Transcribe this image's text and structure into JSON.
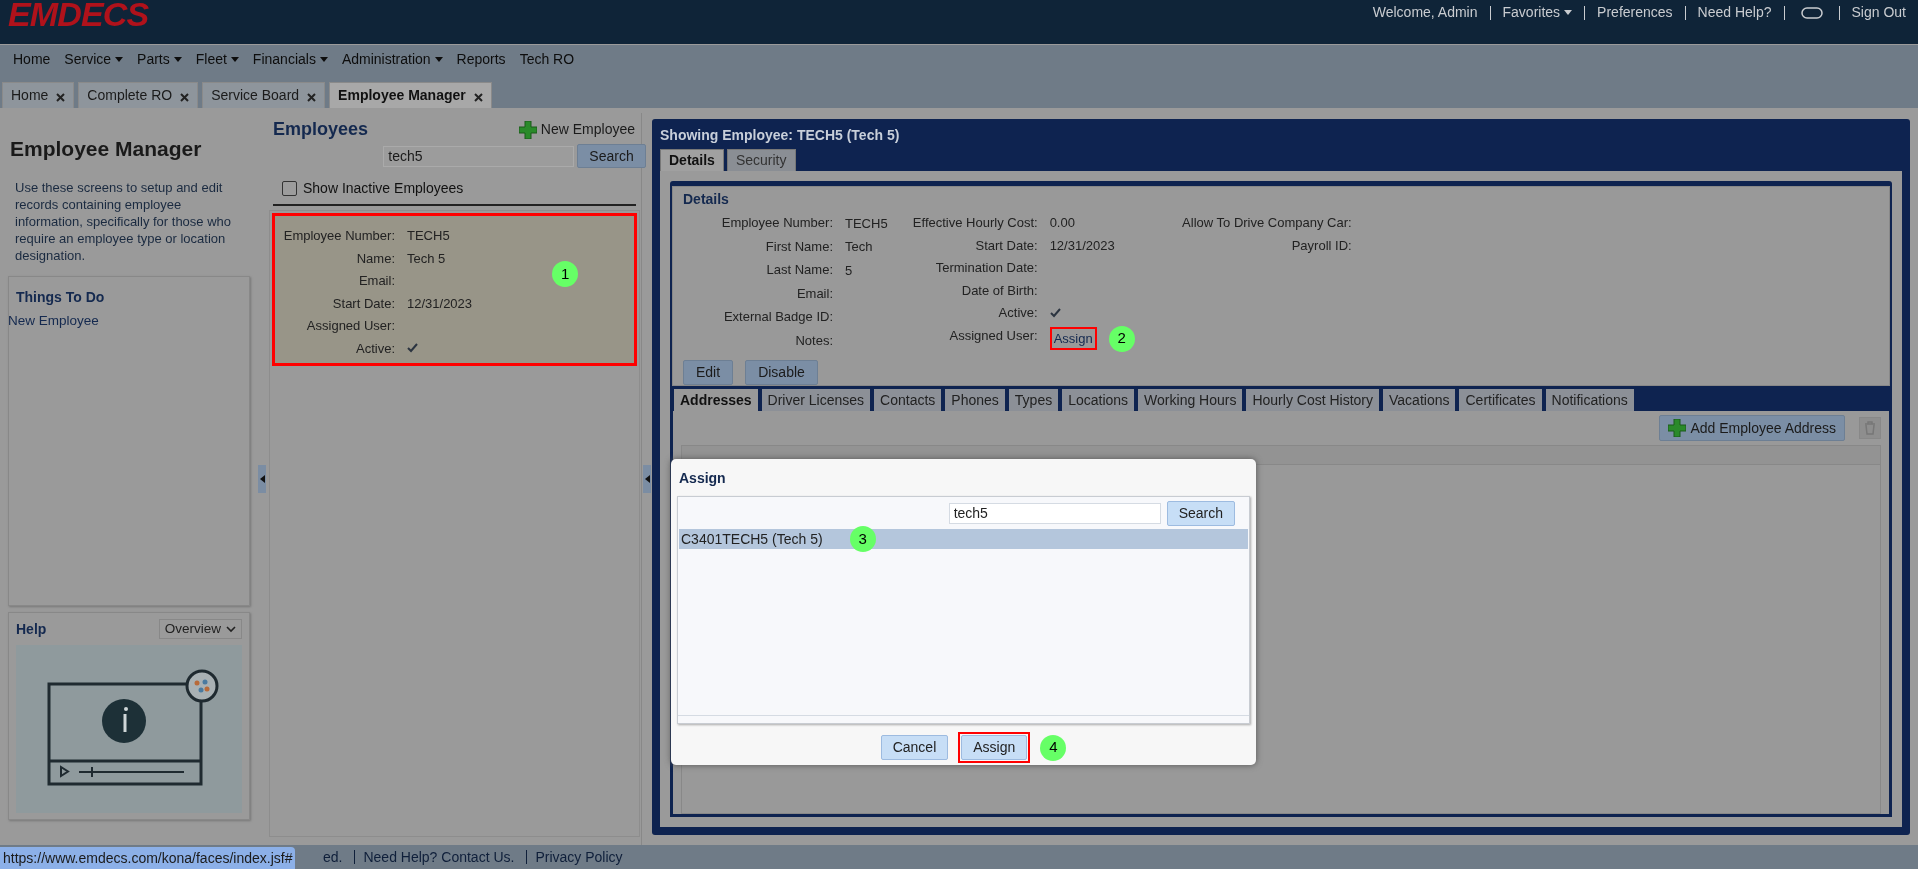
{
  "header": {
    "logo": "EMDECS",
    "links": [
      {
        "label": "Welcome, Admin",
        "kind": "text"
      },
      {
        "label": "Favorites",
        "kind": "menu"
      },
      {
        "label": "Preferences",
        "kind": "link"
      },
      {
        "label": "Need Help?",
        "kind": "link"
      },
      {
        "kind": "toggle"
      },
      {
        "label": "Sign Out",
        "kind": "link"
      }
    ]
  },
  "menu": [
    {
      "label": "Home",
      "dropdown": false
    },
    {
      "label": "Service",
      "dropdown": true
    },
    {
      "label": "Parts",
      "dropdown": true
    },
    {
      "label": "Fleet",
      "dropdown": true
    },
    {
      "label": "Financials",
      "dropdown": true
    },
    {
      "label": "Administration",
      "dropdown": true
    },
    {
      "label": "Reports",
      "dropdown": false
    },
    {
      "label": "Tech RO",
      "dropdown": false
    }
  ],
  "page_tabs": [
    {
      "label": "Home",
      "selected": false
    },
    {
      "label": "Complete RO",
      "selected": false
    },
    {
      "label": "Service Board",
      "selected": false
    },
    {
      "label": "Employee Manager",
      "selected": true
    }
  ],
  "sidebar": {
    "title": "Employee Manager",
    "description": "Use these screens to setup and edit records containing employee information, specifically for those who require an employee type or location designation.",
    "things_to_do": {
      "title": "Things To Do",
      "items": [
        "New Employee"
      ]
    },
    "help": {
      "title": "Help",
      "dropdown": "Overview"
    }
  },
  "employees": {
    "title": "Employees",
    "new_button": "New Employee",
    "search_value": "tech5",
    "search_button": "Search",
    "show_inactive": {
      "label": "Show Inactive Employees",
      "checked": false
    },
    "card": {
      "marker": "1",
      "fields": [
        {
          "label": "Employee Number:",
          "kind": "text",
          "value": "TECH5"
        },
        {
          "label": "Name:",
          "kind": "text",
          "value": "Tech 5"
        },
        {
          "label": "Email:",
          "kind": "text"
        },
        {
          "label": "Start Date:",
          "kind": "text",
          "value": "12/31/2023"
        },
        {
          "label": "Assigned User:",
          "kind": "text"
        },
        {
          "label": "Active:",
          "kind": "check",
          "checked": true
        }
      ]
    }
  },
  "detail": {
    "title": "Showing Employee: TECH5 (Tech 5)",
    "tabs": [
      {
        "label": "Details",
        "selected": true
      },
      {
        "label": "Security",
        "selected": false
      }
    ],
    "section_title": "Details",
    "columns": [
      [
        {
          "label": "Employee Number:",
          "kind": "text",
          "value": "TECH5"
        },
        {
          "label": "First Name:",
          "kind": "text",
          "value": "Tech"
        },
        {
          "label": "Last Name:",
          "kind": "text",
          "value": "5"
        },
        {
          "label": "Email:",
          "kind": "text"
        },
        {
          "label": "External Badge ID:",
          "kind": "text"
        },
        {
          "label": "Notes:",
          "kind": "text"
        }
      ],
      [
        {
          "label": "Effective Hourly Cost:",
          "kind": "text",
          "value": "0.00"
        },
        {
          "label": "Start Date:",
          "kind": "text",
          "value": "12/31/2023"
        },
        {
          "label": "Termination Date:",
          "kind": "text"
        },
        {
          "label": "Date of Birth:",
          "kind": "text"
        },
        {
          "label": "Active:",
          "kind": "check",
          "checked": true
        },
        {
          "label": "Assigned User:",
          "kind": "link",
          "value": "Assign",
          "marker": "2"
        }
      ],
      [
        {
          "label": "Allow To Drive Company Car:",
          "kind": "text"
        },
        {
          "label": "Payroll ID:",
          "kind": "text"
        }
      ]
    ],
    "buttons": [
      "Edit",
      "Disable"
    ],
    "sub_tabs": [
      {
        "label": "Addresses",
        "selected": true
      },
      {
        "label": "Driver Licenses",
        "selected": false
      },
      {
        "label": "Contacts",
        "selected": false
      },
      {
        "label": "Phones",
        "selected": false
      },
      {
        "label": "Types",
        "selected": false
      },
      {
        "label": "Locations",
        "selected": false
      },
      {
        "label": "Working Hours",
        "selected": false
      },
      {
        "label": "Hourly Cost History",
        "selected": false
      },
      {
        "label": "Vacations",
        "selected": false
      },
      {
        "label": "Certificates",
        "selected": false
      },
      {
        "label": "Notifications",
        "selected": false
      }
    ],
    "add_button": "Add Employee Address"
  },
  "dialog": {
    "title": "Assign",
    "search_value": "tech5",
    "search_button": "Search",
    "results": [
      {
        "label": "C3401TECH5 (Tech 5)",
        "selected": true,
        "marker": "3"
      }
    ],
    "cancel_button": "Cancel",
    "assign_button": "Assign",
    "assign_marker": "4"
  },
  "footer": {
    "status_url": "https://www.emdecs.com/kona/faces/index.jsf#",
    "partial_text": "ed.",
    "links": [
      "Need Help? Contact Us.",
      "Privacy Policy"
    ]
  }
}
